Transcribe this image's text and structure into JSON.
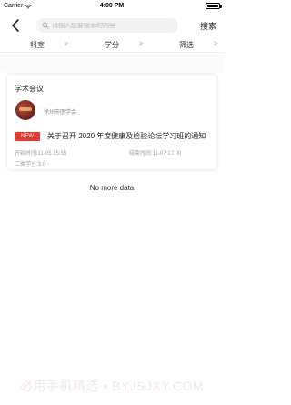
{
  "status_bar": {
    "carrier": "Carrier",
    "time": "4:00 PM"
  },
  "search": {
    "placeholder": "请输入您要搜索的内容",
    "value": "",
    "button_label": "搜索"
  },
  "filters": [
    {
      "label": "科室"
    },
    {
      "label": "学分"
    },
    {
      "label": "筛选"
    }
  ],
  "filter_arrow": ">",
  "results": [
    {
      "category": "学术会议",
      "organizer": "徐州市医学会",
      "badge": "NEW",
      "title": "关于召开 2020 年度健康及检验论坛学习班的通知",
      "start": "开始时间:11-05 15:55",
      "end": "结束时间:11-07 17:00",
      "credit": "二类学分:3.0"
    }
  ],
  "footer": {
    "no_more": "No more data"
  },
  "watermark": "必用手机精选 • BYJSJXY.COM",
  "colors": {
    "badge_red": "#e8382f",
    "search_bg": "#f2f2f4"
  }
}
